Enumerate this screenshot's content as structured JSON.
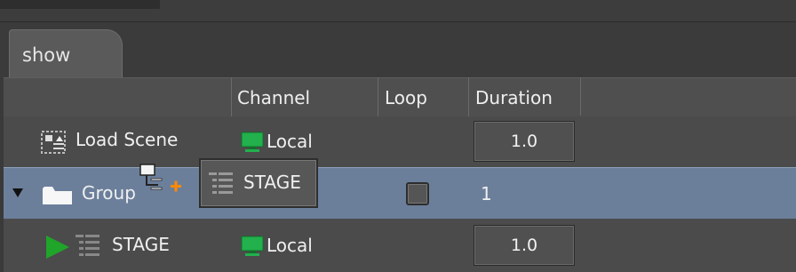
{
  "tabs": [
    {
      "label": "show"
    }
  ],
  "columns": {
    "channel": "Channel",
    "loop": "Loop",
    "duration": "Duration"
  },
  "rows": [
    {
      "name": "Load Scene",
      "channel": "Local",
      "duration": "1.0",
      "icon": "load-scene-icon"
    },
    {
      "name": "Group",
      "channel": "",
      "duration": "1",
      "loop_checked": false,
      "icon": "folder-icon",
      "expanded": true
    },
    {
      "name": "STAGE",
      "channel": "Local",
      "duration": "1.0",
      "icon": "stage-icon"
    }
  ],
  "drag_ghost": {
    "label": "STAGE"
  },
  "colors": {
    "channel_icon": "#22b14c",
    "play_icon": "#1fa52a",
    "selection": "#6b7f9b",
    "add_badge": "#ff8a00"
  }
}
